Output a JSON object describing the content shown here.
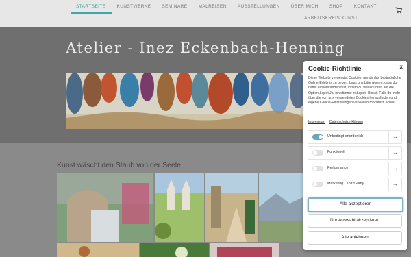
{
  "nav": {
    "items": [
      "Startseite",
      "Kunstwerke",
      "Seminare",
      "Malreisen",
      "Ausstellungen",
      "Über mich",
      "Shop",
      "Kontakt"
    ],
    "second_row": "Arbeitskreis Kunst",
    "cart_icon": "cart-icon"
  },
  "hero": {
    "title": "Atelier - Inez Eckenbach-Henning"
  },
  "content": {
    "tagline": "Kunst wäscht den Staub von der Seele."
  },
  "cookie": {
    "title": "Cookie-Richtlinie",
    "close": "x",
    "text": "Diese Website verwendet Cookies, um dir das bestmögliche Online-Erlebnis zu geben. Lass uns bitte wissen, dass du damit einverstanden bist, indem du weiter unten auf die Option &quot;Ja, ich stimme zu&quot; klickst. Falls du mehr über die von uns verwendeten Cookies herausfinden und eigene Cookie-Einstellungen verwalten möchtest, schau",
    "links": [
      "Impressum",
      "Datenschutzerklärung"
    ],
    "categories": [
      {
        "label": "Unbedingt erforderlich",
        "on": true
      },
      {
        "label": "Funktionell",
        "on": false
      },
      {
        "label": "Performance",
        "on": false
      },
      {
        "label": "Marketing / Third Party",
        "on": false
      }
    ],
    "arrow": "→",
    "buttons": {
      "accept_all": "Alle akzeptieren",
      "accept_selection": "Nur Auswahl akzeptieren",
      "reject_all": "Alle ablehnen"
    }
  },
  "colors": {
    "accent": "#43a6a6",
    "hero_bg": "#6f6f6f",
    "toggle_on": "#6aa7b8"
  }
}
